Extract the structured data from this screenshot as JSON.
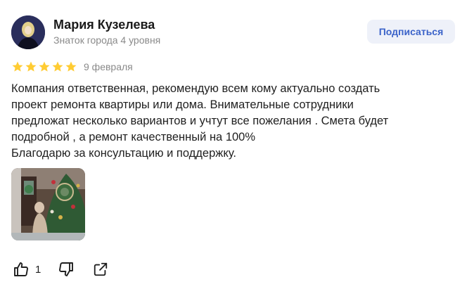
{
  "author": {
    "name": "Мария Кузелева",
    "level": "Знаток города 4 уровня"
  },
  "subscribe_label": "Подписаться",
  "rating": 5,
  "date": "9 февраля",
  "review_lines": [
    "Компания ответственная, рекомендую всем кому актуально создать",
    "проект ремонта квартиры или дома. Внимательные сотрудники",
    "предложат несколько вариантов и учтут все пожелания . Смета будет",
    "подробной , а ремонт качественный на 100%",
    "Благодарю за консультацию и поддержку."
  ],
  "actions": {
    "like_count": "1"
  },
  "colors": {
    "star": "#fc3",
    "accent": "#3b63c9",
    "button_bg": "#eef1f9",
    "muted": "#8a8a8a"
  },
  "icons": [
    "thumb-up-icon",
    "thumb-down-icon",
    "share-icon",
    "star-icon"
  ]
}
